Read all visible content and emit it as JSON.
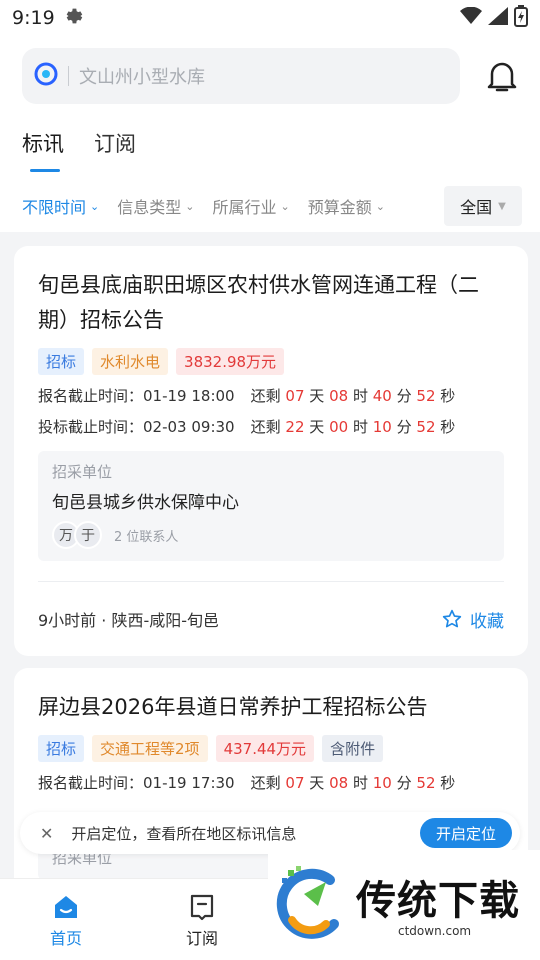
{
  "status_bar": {
    "time": "9:19"
  },
  "search": {
    "placeholder": "文山州小型水库"
  },
  "tabs": [
    {
      "label": "标讯",
      "active": true
    },
    {
      "label": "订阅",
      "active": false
    }
  ],
  "filters": [
    {
      "label": "不限时间",
      "active": true
    },
    {
      "label": "信息类型",
      "active": false
    },
    {
      "label": "所属行业",
      "active": false
    },
    {
      "label": "预算金额",
      "active": false
    }
  ],
  "region": "全国",
  "cards": [
    {
      "title": "旬邑县底庙职田塬区农村供水管网连通工程（二期）招标公告",
      "tags": [
        "招标",
        "水利水电",
        "3832.98万元"
      ],
      "deadlines": [
        {
          "label": "报名截止时间：",
          "date": "01-19 18:00",
          "remain": "还剩",
          "d": "07",
          "h": "08",
          "m": "40",
          "s": "52",
          "u_d": "天",
          "u_h": "时",
          "u_m": "分",
          "u_s": "秒"
        },
        {
          "label": "投标截止时间：",
          "date": "02-03 09:30",
          "remain": "还剩",
          "d": "22",
          "h": "00",
          "m": "10",
          "s": "52",
          "u_d": "天",
          "u_h": "时",
          "u_m": "分",
          "u_s": "秒"
        }
      ],
      "unit_label": "招采单位",
      "unit_name": "旬邑县城乡供水保障中心",
      "avatars": [
        "万",
        "于"
      ],
      "contacts": "2 位联系人",
      "meta": "9小时前 · 陕西-咸阳-旬邑",
      "fav": "收藏"
    },
    {
      "title": "屏边县2026年县道日常养护工程招标公告",
      "tags": [
        "招标",
        "交通工程等2项",
        "437.44万元",
        "含附件"
      ],
      "deadlines": [
        {
          "label": "报名截止时间：",
          "date": "01-19 17:30",
          "remain": "还剩",
          "d": "07",
          "h": "08",
          "m": "10",
          "s": "52",
          "u_d": "天",
          "u_h": "时",
          "u_m": "分",
          "u_s": "秒"
        }
      ],
      "unit_label": "招采单位"
    }
  ],
  "location_bar": {
    "text": "开启定位，查看所在地区标讯信息",
    "button": "开启定位"
  },
  "bottom_nav": [
    {
      "label": "首页",
      "active": true
    },
    {
      "label": "订阅",
      "active": false
    }
  ],
  "watermark": {
    "title": "传统下载",
    "url": "ctdown.com"
  },
  "colors": {
    "accent": "#1e88e5",
    "red": "#e53935"
  }
}
